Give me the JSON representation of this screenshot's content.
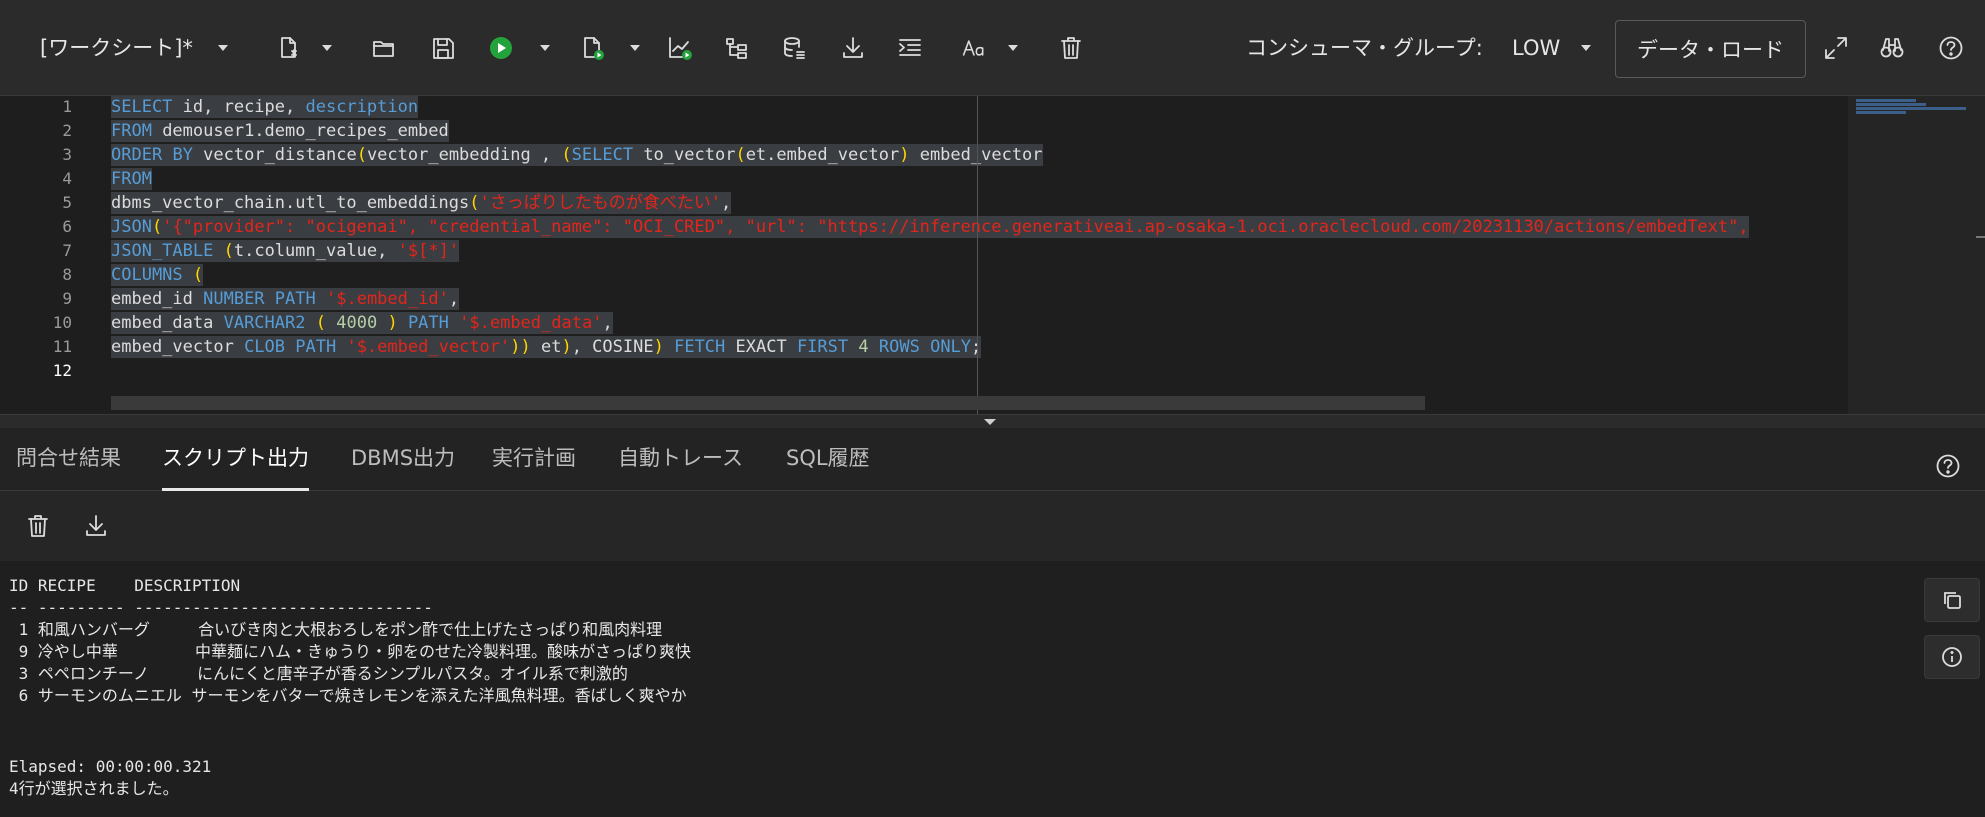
{
  "toolbar": {
    "worksheet_label": "[ワークシート]*",
    "consumer_group_label": "コンシューマ・グループ:",
    "consumer_group_value": "LOW",
    "data_load_label": "データ・ロード",
    "run_color": "#22a33c"
  },
  "editor": {
    "line_numbers": [
      "1",
      "2",
      "3",
      "4",
      "5",
      "6",
      "7",
      "8",
      "9",
      "10",
      "11",
      "12"
    ],
    "lines": [
      "SELECT id, recipe, description",
      "FROM demouser1.demo_recipes_embed",
      "ORDER BY vector_distance(vector_embedding , (SELECT to_vector(et.embed_vector) embed_vector",
      "FROM",
      "dbms_vector_chain.utl_to_embeddings('さっぱりしたものが食べたい',",
      "JSON('{\"provider\": \"ocigenai\", \"credential_name\": \"OCI_CRED\", \"url\": \"https://inference.generativeai.ap-osaka-1.oci.oraclecloud.com/20231130/actions/embedText\",",
      "JSON_TABLE (t.column_value, '$[*]'",
      "COLUMNS (",
      "embed_id NUMBER PATH '$.embed_id',",
      "embed_data VARCHAR2 ( 4000 ) PATH '$.embed_data',",
      "embed_vector CLOB PATH '$.embed_vector')) et), COSINE) FETCH EXACT FIRST 4 ROWS ONLY;",
      ""
    ]
  },
  "tabs": [
    "問合せ結果",
    "スクリプト出力",
    "DBMS出力",
    "実行計画",
    "自動トレース",
    "SQL履歴"
  ],
  "active_tab": "スクリプト出力",
  "output": {
    "header": "ID RECIPE    DESCRIPTION",
    "separator": "-- --------- -------------------------------",
    "rows": [
      " 1 和風ハンバーグ     合いびき肉と大根おろしをポン酢で仕上げたさっぱり和風肉料理",
      " 9 冷やし中華        中華麺にハム・きゅうり・卵をのせた冷製料理。酸味がさっぱり爽快",
      " 3 ペペロンチーノ     にんにくと唐辛子が香るシンプルパスタ。オイル系で刺激的",
      " 6 サーモンのムニエル サーモンをバターで焼きレモンを添えた洋風魚料理。香ばしく爽やか"
    ],
    "elapsed": "Elapsed: 00:00:00.321",
    "rows_selected": "4行が選択されました。"
  }
}
